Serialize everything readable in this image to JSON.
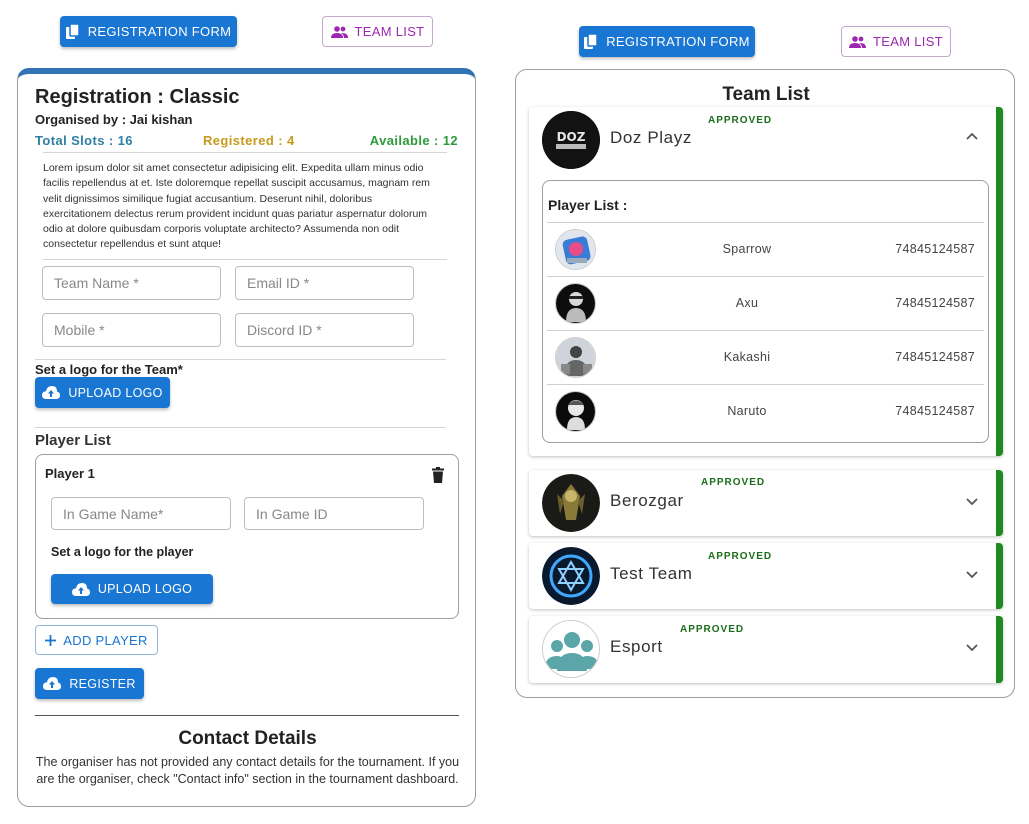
{
  "top_left": {
    "registration_button": "Registration Form",
    "team_list_button": "Team List"
  },
  "top_right": {
    "registration_button": "Registration Form",
    "team_list_button": "Team List"
  },
  "registration": {
    "title": "Registration : Classic",
    "organiser": "Organised by : Jai kishan",
    "total_slots": "Total Slots : 16",
    "registered": "Registered : 4",
    "available": "Available : 12",
    "description": "Lorem ipsum dolor sit amet consectetur adipisicing elit. Expedita ullam minus odio facilis repellendus at et. Iste doloremque repellat suscipit accusamus, magnam rem velit dignissimos similique fugiat accusantium. Deserunt nihil, doloribus exercitationem delectus rerum provident incidunt quas pariatur aspernatur dolorum odio at dolore quibusdam corporis voluptate architecto? Assumenda non odit consectetur repellendus et sunt atque!",
    "fields": {
      "team_name": "Team Name *",
      "email": "Email ID *",
      "mobile": "Mobile *",
      "discord": "Discord ID *"
    },
    "team_logo_label": "Set a logo for the Team*",
    "upload_logo": "Upload Logo",
    "player_list_title": "Player List",
    "player": {
      "title": "Player 1",
      "ign": "In Game Name*",
      "igid": "In Game ID",
      "logo_label": "Set a logo for the player",
      "upload_logo": "Upload Logo"
    },
    "add_player": "Add Player",
    "register": "Register",
    "contact_title": "Contact Details",
    "contact_text": "The organiser has not provided any contact details for the tournament. If you are the organiser, check \"Contact info\" section in the tournament dashboard."
  },
  "team_list": {
    "title": "Team List",
    "approved_label": "APPROVED",
    "teams": [
      {
        "name": "Doz Playz",
        "status": "APPROVED",
        "expanded": true,
        "logo_text": "DOZ"
      },
      {
        "name": "Berozgar",
        "status": "APPROVED",
        "expanded": false
      },
      {
        "name": "Test Team",
        "status": "APPROVED",
        "expanded": false
      },
      {
        "name": "Esport",
        "status": "APPROVED",
        "expanded": false
      }
    ],
    "player_list_label": "Player List :",
    "players": [
      {
        "name": "Sparrow",
        "phone": "74845124587"
      },
      {
        "name": "Axu",
        "phone": "74845124587"
      },
      {
        "name": "Kakashi",
        "phone": "74845124587"
      },
      {
        "name": "Naruto",
        "phone": "74845124587"
      }
    ]
  },
  "colors": {
    "primary": "#1976d2",
    "purple": "#9c27b0",
    "approved_bar": "#1f8a1f",
    "total_slots": "#2e7fa3",
    "registered": "#c79a1d",
    "available": "#2e9a3c"
  }
}
